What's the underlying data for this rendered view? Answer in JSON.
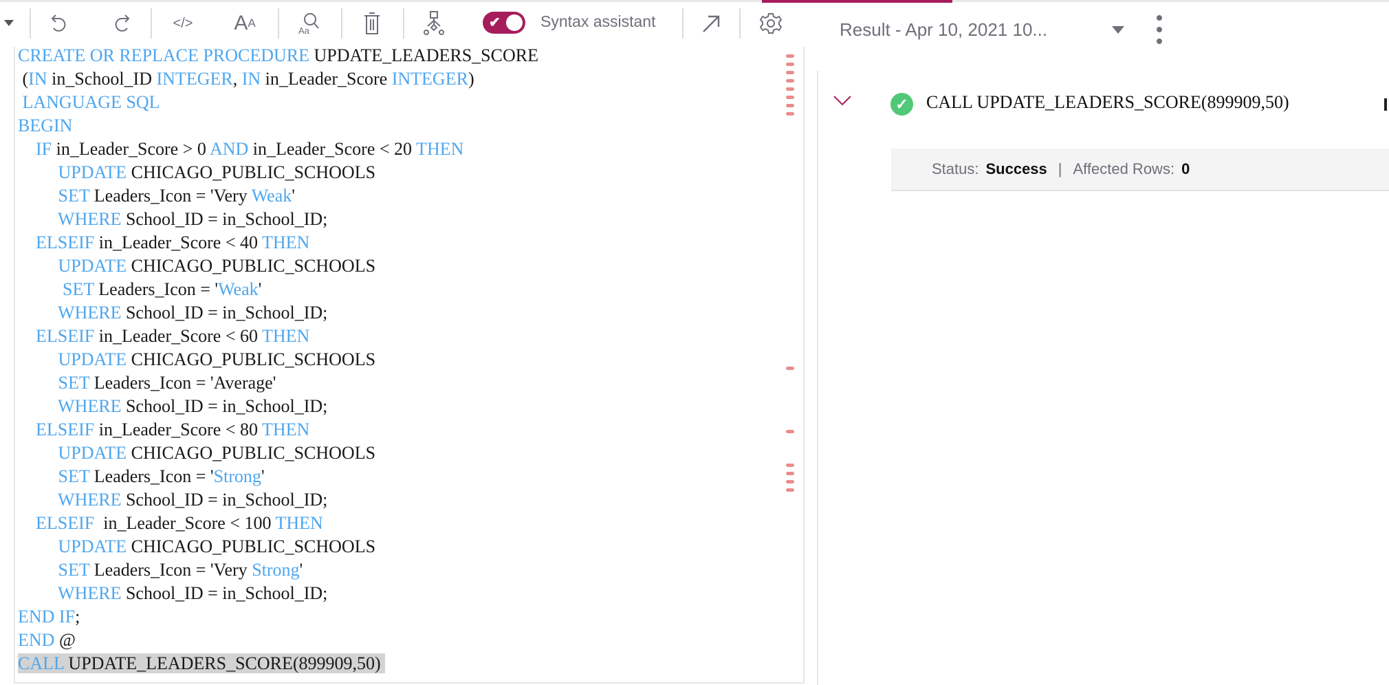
{
  "toolbar": {
    "syntax_assistant_label": "Syntax assistant",
    "syntax_assistant_on": true,
    "accent": "#a61d5c",
    "icons": [
      "caret-down-icon",
      "undo-icon",
      "redo-icon",
      "code-icon",
      "font-size-icon",
      "find-replace-icon",
      "trash-icon",
      "flow-icon",
      "expand-arrow-icon",
      "gear-icon"
    ]
  },
  "editor": {
    "keyword_color": "#4ea6ee",
    "highlighted_line": 26,
    "lines": [
      [
        [
          "CREATE OR REPLACE PROCEDURE",
          "k"
        ],
        [
          " UPDATE_LEADERS_SCORE",
          "n"
        ]
      ],
      [
        [
          " (",
          "n"
        ],
        [
          "IN",
          "k"
        ],
        [
          " in_School_ID ",
          "n"
        ],
        [
          "INTEGER",
          "k"
        ],
        [
          ", ",
          "n"
        ],
        [
          "IN",
          "k"
        ],
        [
          " in_Leader_Score ",
          "n"
        ],
        [
          "INTEGER",
          "k"
        ],
        [
          ")",
          "n"
        ]
      ],
      [
        [
          " ",
          "n"
        ],
        [
          "LANGUAGE SQL",
          "k"
        ]
      ],
      [
        [
          "BEGIN",
          "k"
        ]
      ],
      [
        [
          "    ",
          "n"
        ],
        [
          "IF",
          "k"
        ],
        [
          " in_Leader_Score > 0 ",
          "n"
        ],
        [
          "AND",
          "k"
        ],
        [
          " in_Leader_Score < 20 ",
          "n"
        ],
        [
          "THEN",
          "k"
        ]
      ],
      [
        [
          "         ",
          "n"
        ],
        [
          "UPDATE",
          "k"
        ],
        [
          " CHICAGO_PUBLIC_SCHOOLS",
          "n"
        ]
      ],
      [
        [
          "         ",
          "n"
        ],
        [
          "SET",
          "k"
        ],
        [
          " Leaders_Icon = 'Very ",
          "n"
        ],
        [
          "Weak",
          "k"
        ],
        [
          "'",
          "n"
        ]
      ],
      [
        [
          "         ",
          "n"
        ],
        [
          "WHERE",
          "k"
        ],
        [
          " School_ID = in_School_ID;",
          "n"
        ]
      ],
      [
        [
          "    ",
          "n"
        ],
        [
          "ELSEIF",
          "k"
        ],
        [
          " in_Leader_Score < 40 ",
          "n"
        ],
        [
          "THEN",
          "k"
        ]
      ],
      [
        [
          "         ",
          "n"
        ],
        [
          "UPDATE",
          "k"
        ],
        [
          " CHICAGO_PUBLIC_SCHOOLS",
          "n"
        ]
      ],
      [
        [
          "          ",
          "n"
        ],
        [
          "SET",
          "k"
        ],
        [
          " Leaders_Icon = '",
          "n"
        ],
        [
          "Weak",
          "k"
        ],
        [
          "'",
          "n"
        ]
      ],
      [
        [
          "         ",
          "n"
        ],
        [
          "WHERE",
          "k"
        ],
        [
          " School_ID = in_School_ID;",
          "n"
        ]
      ],
      [
        [
          "    ",
          "n"
        ],
        [
          "ELSEIF",
          "k"
        ],
        [
          " in_Leader_Score < 60 ",
          "n"
        ],
        [
          "THEN",
          "k"
        ]
      ],
      [
        [
          "         ",
          "n"
        ],
        [
          "UPDATE",
          "k"
        ],
        [
          " CHICAGO_PUBLIC_SCHOOLS",
          "n"
        ]
      ],
      [
        [
          "         ",
          "n"
        ],
        [
          "SET",
          "k"
        ],
        [
          " Leaders_Icon = 'Average'",
          "n"
        ]
      ],
      [
        [
          "         ",
          "n"
        ],
        [
          "WHERE",
          "k"
        ],
        [
          " School_ID = in_School_ID;",
          "n"
        ]
      ],
      [
        [
          "    ",
          "n"
        ],
        [
          "ELSEIF",
          "k"
        ],
        [
          " in_Leader_Score < 80 ",
          "n"
        ],
        [
          "THEN",
          "k"
        ]
      ],
      [
        [
          "         ",
          "n"
        ],
        [
          "UPDATE",
          "k"
        ],
        [
          " CHICAGO_PUBLIC_SCHOOLS",
          "n"
        ]
      ],
      [
        [
          "         ",
          "n"
        ],
        [
          "SET",
          "k"
        ],
        [
          " Leaders_Icon = '",
          "n"
        ],
        [
          "Strong",
          "k"
        ],
        [
          "'",
          "n"
        ]
      ],
      [
        [
          "         ",
          "n"
        ],
        [
          "WHERE",
          "k"
        ],
        [
          " School_ID = in_School_ID;",
          "n"
        ]
      ],
      [
        [
          "    ",
          "n"
        ],
        [
          "ELSEIF",
          "k"
        ],
        [
          "  in_Leader_Score < 100 ",
          "n"
        ],
        [
          "THEN",
          "k"
        ]
      ],
      [
        [
          "         ",
          "n"
        ],
        [
          "UPDATE",
          "k"
        ],
        [
          " CHICAGO_PUBLIC_SCHOOLS",
          "n"
        ]
      ],
      [
        [
          "         ",
          "n"
        ],
        [
          "SET",
          "k"
        ],
        [
          " Leaders_Icon = 'Very ",
          "n"
        ],
        [
          "Strong",
          "k"
        ],
        [
          "'",
          "n"
        ]
      ],
      [
        [
          "         ",
          "n"
        ],
        [
          "WHERE",
          "k"
        ],
        [
          " School_ID = in_School_ID;",
          "n"
        ]
      ],
      [
        [
          "END IF",
          "k"
        ],
        [
          ";",
          "n"
        ]
      ],
      [
        [
          "END",
          "k"
        ],
        [
          " @",
          "n"
        ]
      ],
      [
        [
          "CALL",
          "k"
        ],
        [
          " UPDATE_LEADERS_SCORE(899909,50) ",
          "n"
        ]
      ]
    ]
  },
  "result": {
    "title": "Result - Apr 10, 2021 10...",
    "statement": "CALL UPDATE_LEADERS_SCORE(899909,50)",
    "status_label": "Status:",
    "status_value": "Success",
    "divider": "|",
    "affected_label": "Affected Rows:",
    "affected_value": "0",
    "success_color": "#50c878"
  }
}
